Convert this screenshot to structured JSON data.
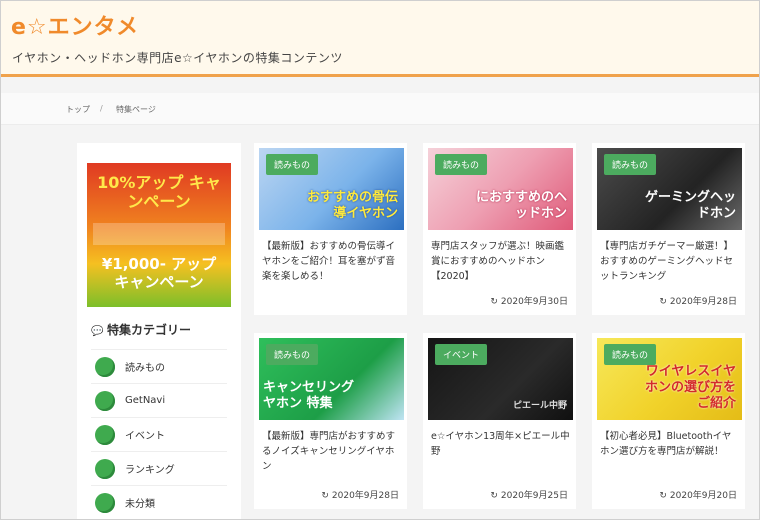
{
  "header": {
    "site_title": "e☆エンタメ",
    "description": "イヤホン・ヘッドホン専門店e☆イヤホンの特集コンテンツ"
  },
  "breadcrumb": {
    "home": "トップ",
    "separator": "/",
    "current": "特集ページ"
  },
  "sidebar": {
    "banner": {
      "line1": "10%アップ キャンペーン",
      "line2": "¥1,000- アップキャンペーン"
    },
    "categories_heading": "特集カテゴリー",
    "categories": [
      {
        "label": "読みもの"
      },
      {
        "label": "GetNavi"
      },
      {
        "label": "イベント"
      },
      {
        "label": "ランキング"
      },
      {
        "label": "未分類"
      }
    ]
  },
  "cards": [
    {
      "badge": "読みもの",
      "thumb_text": "おすすめの骨伝導イヤホン",
      "title": "【最新版】おすすめの骨伝導イヤホンをご紹介！耳を塞がず音楽を楽しめる！",
      "date": ""
    },
    {
      "badge": "読みもの",
      "thumb_text": "におすすめのヘッドホン",
      "title": "専門店スタッフが選ぶ！映画鑑賞におすすめのヘッドホン【2020】",
      "date": "2020年9月30日"
    },
    {
      "badge": "読みもの",
      "thumb_text": "ゲーミングヘッドホン",
      "title": "【専門店ガチゲーマー厳選！】おすすめのゲーミングヘッドセットランキング",
      "date": "2020年9月28日"
    },
    {
      "badge": "読みもの",
      "thumb_text": "キャンセリングヤホン 特集",
      "title": "【最新版】専門店がおすすめするノイズキャンセリングイヤホン",
      "date": "2020年9月28日"
    },
    {
      "badge": "イベント",
      "thumb_text": "ピエール中野",
      "title": "e☆イヤホン13周年×ピエール中野",
      "date": "2020年9月25日"
    },
    {
      "badge": "読みもの",
      "thumb_text": "ワイヤレスイヤホンの選び方をご紹介",
      "title": "【初心者必見】Bluetoothイヤホン選び方を専門店が解説！",
      "date": "2020年9月20日"
    }
  ],
  "colors": {
    "accent": "#f08a2b",
    "badge": "#4cab5f",
    "header_bg": "#fff9ec"
  },
  "icons": {
    "category_heading": "comment-icon",
    "date": "clock-history-icon",
    "category": "green-circle-icon"
  }
}
